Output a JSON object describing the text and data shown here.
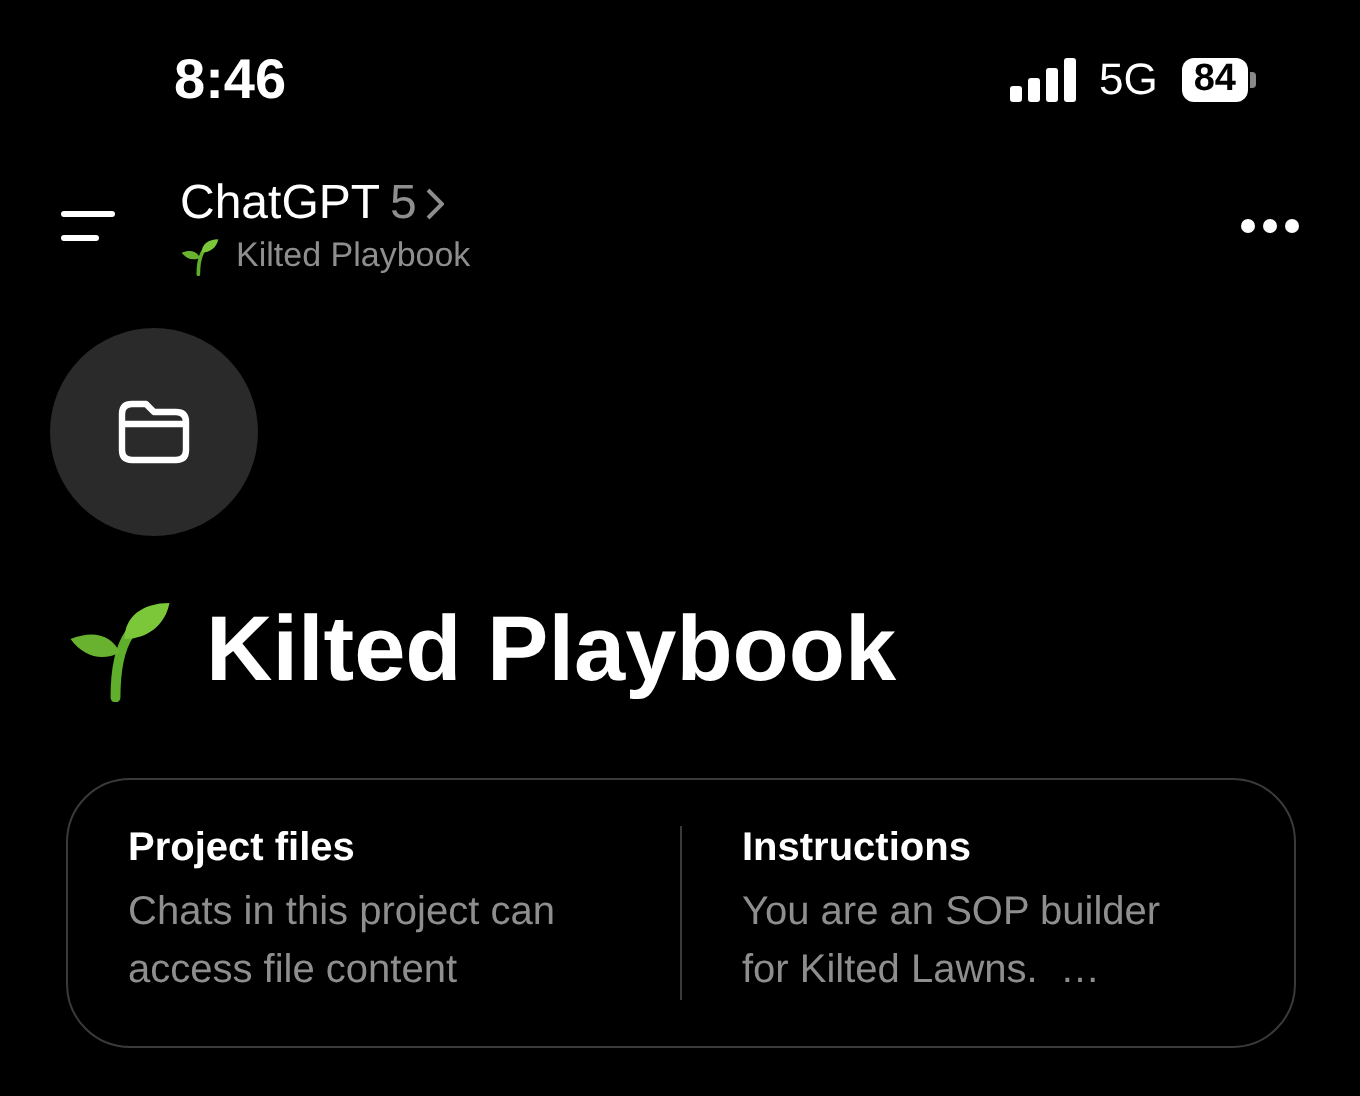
{
  "status_bar": {
    "time": "8:46",
    "network": "5G",
    "battery": "84"
  },
  "header": {
    "title": "ChatGPT",
    "model": "5",
    "subtitle": "Kilted Playbook"
  },
  "project": {
    "title": "Kilted Playbook"
  },
  "cards": [
    {
      "heading": "Project files",
      "text": "Chats in this project can access file content"
    },
    {
      "heading": "Instructions",
      "text": "You are an SOP builder for Kilted Lawns.  …"
    }
  ]
}
